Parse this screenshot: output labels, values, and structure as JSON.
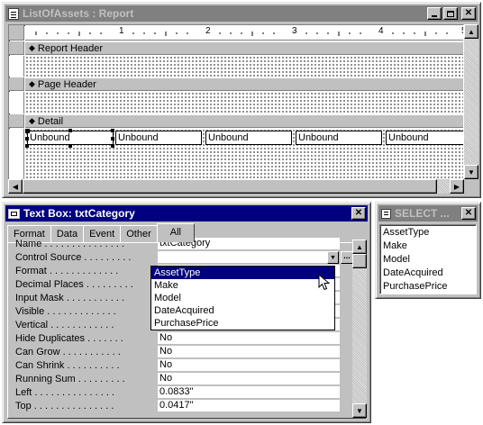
{
  "report_window": {
    "title": "ListOfAssets : Report",
    "ruler_numbers": [
      "1",
      "2",
      "3",
      "4",
      "5"
    ],
    "sections": [
      {
        "label": "Report Header"
      },
      {
        "label": "Page Header"
      },
      {
        "label": "Detail"
      }
    ],
    "controls": [
      "Unbound",
      "Unbound",
      "Unbound",
      "Unbound",
      "Unbound"
    ]
  },
  "textbox_window": {
    "title": "Text Box: txtCategory",
    "tabs": [
      "Format",
      "Data",
      "Event",
      "Other",
      "All"
    ],
    "selected_tab": "All",
    "properties": [
      {
        "label": "Name . . . . . . . . . . . . . . .",
        "value": "txtCategory"
      },
      {
        "label": "Control Source . . . . . . . . .",
        "value": ""
      },
      {
        "label": "Format . . . . . . . . . . . . .",
        "value": ""
      },
      {
        "label": "Decimal Places . . . . . . . . .",
        "value": ""
      },
      {
        "label": "Input Mask . . . . . . . . . . .",
        "value": ""
      },
      {
        "label": "Visible . . . . . . . . . . . . .",
        "value": ""
      },
      {
        "label": "Vertical . . . . . . . . . . . .",
        "value": ""
      },
      {
        "label": "Hide Duplicates . . . . . . .",
        "value": "No"
      },
      {
        "label": "Can Grow . . . . . . . . . . .",
        "value": "No"
      },
      {
        "label": "Can Shrink . . . . . . . . . .",
        "value": "No"
      },
      {
        "label": "Running Sum . . . . . . . . .",
        "value": "No"
      },
      {
        "label": "Left . . . . . . . . . . . . . . .",
        "value": "0.0833\""
      },
      {
        "label": "Top . . . . . . . . . . . . . . .",
        "value": "0.0417\""
      }
    ],
    "dropdown_options": [
      "AssetType",
      "Make",
      "Model",
      "DateAcquired",
      "PurchasePrice"
    ],
    "dropdown_selected": "AssetType",
    "builder_button": "..."
  },
  "field_list_window": {
    "title": "SELECT ...",
    "fields": [
      "AssetType",
      "Make",
      "Model",
      "DateAcquired",
      "PurchasePrice"
    ]
  },
  "icons": [
    "report-icon",
    "textbox-icon",
    "field-list-icon",
    "section-arrow-icon",
    "dropdown-arrow-icon",
    "mouse-cursor-icon"
  ],
  "colors": {
    "active_title": "#000080",
    "inactive_title": "#808080",
    "window_face": "#c0c0c0",
    "selection": "#000080"
  }
}
